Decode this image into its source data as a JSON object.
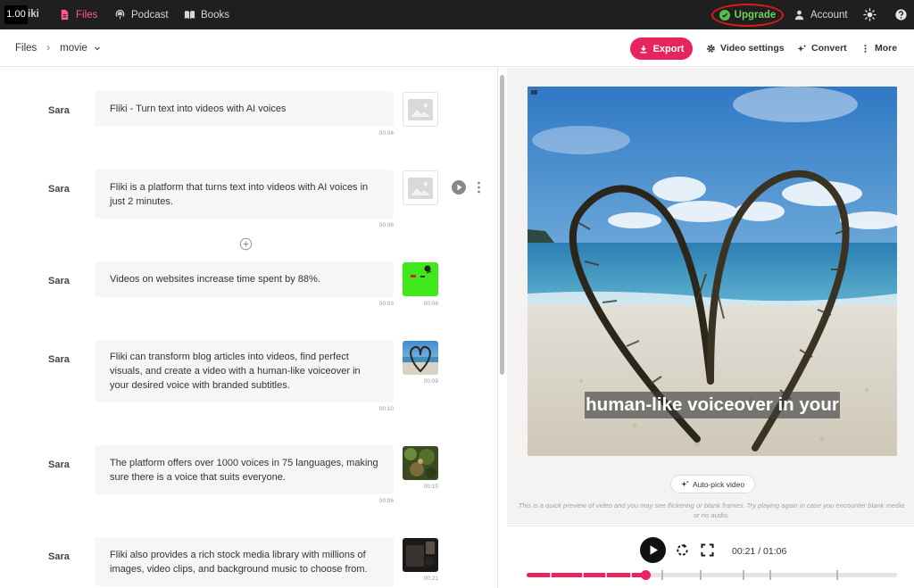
{
  "overlay": {
    "zoom_badge": "1.00",
    "brand_fragment": "iki"
  },
  "nav": {
    "items": [
      {
        "label": "Files",
        "icon": "file-icon"
      },
      {
        "label": "Podcast",
        "icon": "podcast-icon"
      },
      {
        "label": "Books",
        "icon": "book-icon"
      }
    ],
    "upgrade_label": "Upgrade",
    "account_label": "Account",
    "colors": {
      "bar": "#1f1f1f",
      "active": "#ff5a8a",
      "upgrade": "#6ed35a",
      "highlight_ring": "#e01818"
    }
  },
  "toolbar": {
    "breadcrumb": {
      "root": "Files",
      "separator": "›",
      "current": "movie"
    },
    "export_label": "Export",
    "video_settings_label": "Video settings",
    "convert_label": "Convert",
    "more_label": "More",
    "accent": "#e8245e"
  },
  "script": {
    "blocks": [
      {
        "speaker": "Sara",
        "text": "Fliki - Turn text into videos with AI voices",
        "duration": "00:04",
        "media": "image-placeholder"
      },
      {
        "speaker": "Sara",
        "text": "Fliki is a platform that turns text into videos with AI voices in just 2 minutes.",
        "duration": "00:06",
        "media": "image-placeholder"
      },
      {
        "speaker": "Sara",
        "text": "Videos on websites increase time spent by 88%.",
        "duration": "00:03",
        "media": "green-screen-clip",
        "media_duration": "00:06"
      },
      {
        "speaker": "Sara",
        "text": "Fliki can transform blog articles into videos, find perfect visuals, and create a video with a human-like voiceover in your desired voice with branded subtitles.",
        "duration": "00:10",
        "media": "beach-heart-clip",
        "media_duration": "00:09"
      },
      {
        "speaker": "Sara",
        "text": "The platform offers over 1000 voices in 75 languages, making sure there is a voice that suits everyone.",
        "duration": "00:06",
        "media": "forest-clip",
        "media_duration": "00:15"
      },
      {
        "speaker": "Sara",
        "text": "Fliki also provides a rich stock media library with millions of images, video clips, and background music to choose from.",
        "duration": "",
        "media": "dark-clip",
        "media_duration": "00:21"
      }
    ]
  },
  "preview": {
    "caption": "human-like voiceover in your",
    "autopick_label": "Auto-pick video",
    "notice": "This is a quick preview of video and you may see flickering or blank frames. Try playing again in case you encounter blank media or no audio.",
    "current_time": "00:21",
    "total_time": "01:06",
    "time_display": "00:21 / 01:06",
    "progress": 0.32
  }
}
